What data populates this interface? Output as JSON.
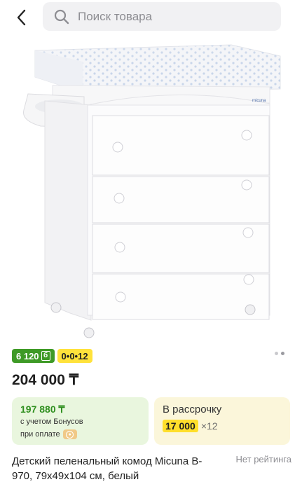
{
  "header": {
    "search_placeholder": "Поиск товара"
  },
  "badges": {
    "bonus_amount": "6 120",
    "bonus_icon": "б",
    "installment": "0•0•12"
  },
  "gallery": {
    "slides": 2,
    "active_slide": 1
  },
  "price": "204 000 ₸",
  "bonus_card": {
    "amount": "197 880 ₸",
    "note_line1": "с учетом Бонусов",
    "note_line2": "при оплате",
    "coin_icon": "bonus-coin-icon"
  },
  "installment_card": {
    "title": "В рассрочку",
    "monthly": "17 000",
    "months": "×12"
  },
  "product": {
    "title": "Детский пеленальный комод Micuna B-970, 79x49x104 см, белый",
    "rating": "Нет рейтинга"
  },
  "colors": {
    "bonus_green": "#3e9a26",
    "install_yellow": "#ffe23b",
    "bonus_card_bg": "#e9f6de",
    "install_card_bg": "#fbf6da"
  }
}
